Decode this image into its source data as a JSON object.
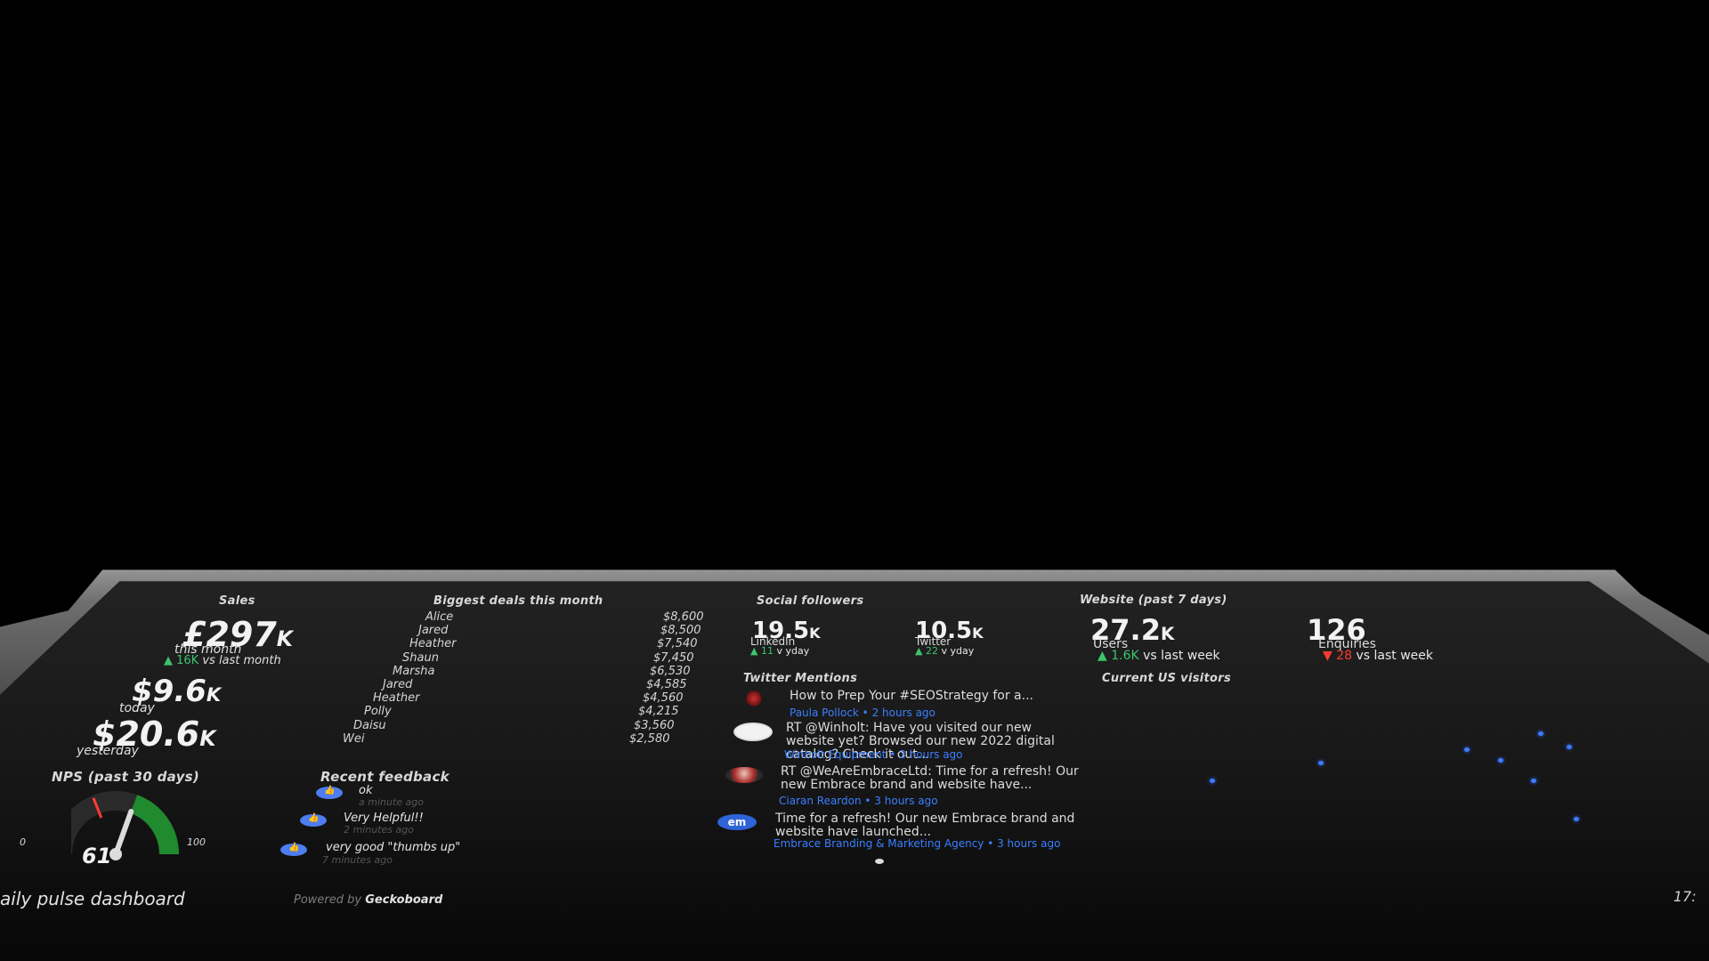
{
  "sales": {
    "title": "Sales",
    "month_value": "£297",
    "month_unit": "K",
    "month_label": "this month",
    "month_delta": "▲ 16K",
    "month_delta_suffix": "vs last month",
    "today_value": "$9.6",
    "today_unit": "K",
    "today_label": "today",
    "yesterday_value": "$20.6",
    "yesterday_unit": "K",
    "yesterday_label": "yesterday"
  },
  "deals": {
    "title": "Biggest deals this month",
    "rows": [
      {
        "name": "Alice",
        "value": "$8,600"
      },
      {
        "name": "Jared",
        "value": "$8,500"
      },
      {
        "name": "Heather",
        "value": "$7,540"
      },
      {
        "name": "Shaun",
        "value": "$7,450"
      },
      {
        "name": "Marsha",
        "value": "$6,530"
      },
      {
        "name": "Jared",
        "value": "$4,585"
      },
      {
        "name": "Heather",
        "value": "$4,560"
      },
      {
        "name": "Polly",
        "value": "$4,215"
      },
      {
        "name": "Daisu",
        "value": "$3,560"
      },
      {
        "name": "Wei",
        "value": "$2,580"
      }
    ]
  },
  "social": {
    "title": "Social followers",
    "linkedin_value": "19.5",
    "linkedin_unit": "K",
    "linkedin_label": "LinkedIn",
    "linkedin_delta": "▲ 11",
    "linkedin_delta_suffix": "v yday",
    "twitter_value": "10.5",
    "twitter_unit": "K",
    "twitter_label": "Twitter",
    "twitter_delta": "▲ 22",
    "twitter_delta_suffix": "v yday"
  },
  "website": {
    "title": "Website (past 7 days)",
    "users_value": "27.2",
    "users_unit": "K",
    "users_label": "Users",
    "users_delta": "▲ 1.6K",
    "users_delta_suffix": "vs last week",
    "enq_value": "126",
    "enq_label": "Enquiries",
    "enq_delta": "▼ 28",
    "enq_delta_suffix": "vs last week"
  },
  "twitter": {
    "title": "Twitter Mentions",
    "tweets": [
      {
        "text": "How to Prep Your #SEOStrategy for a...",
        "meta": "Paula Pollock • 2 hours ago"
      },
      {
        "text": "RT @Winholt: Have you visited our new website yet? Browsed our new 2022 digital catalog? Check it out...",
        "meta": "Winholt Equipment • 3 hours ago"
      },
      {
        "text": "RT @WeAreEmbraceLtd: Time for a refresh! Our new Embrace brand and website have...",
        "meta": "Ciaran Reardon • 3 hours ago"
      },
      {
        "text": "Time for a refresh! Our new Embrace brand and website have launched...",
        "meta": "Embrace Branding & Marketing Agency • 3 hours ago"
      }
    ],
    "avatar_em": "em"
  },
  "visitors": {
    "title": "Current US visitors"
  },
  "nps": {
    "title": "NPS (past 30 days)",
    "value": "61",
    "score": 61,
    "min": "0",
    "max": "100"
  },
  "feedback": {
    "title": "Recent feedback",
    "items": [
      {
        "text": "ok",
        "time": "a minute ago"
      },
      {
        "text": "Very Helpful!!",
        "time": "2 minutes ago"
      },
      {
        "text": "very good \"thumbs up\"",
        "time": "7 minutes ago"
      }
    ]
  },
  "footer": {
    "dashboard_name": "aily pulse dashboard",
    "powered_by": "Powered by",
    "brand": "Geckoboard",
    "clock": "17:"
  },
  "colors": {
    "positive": "#3ec46d",
    "negative": "#ff3b30",
    "link": "#3a7fff",
    "gauge_fill": "#1f8a2e",
    "needle": "#ff3b30"
  }
}
